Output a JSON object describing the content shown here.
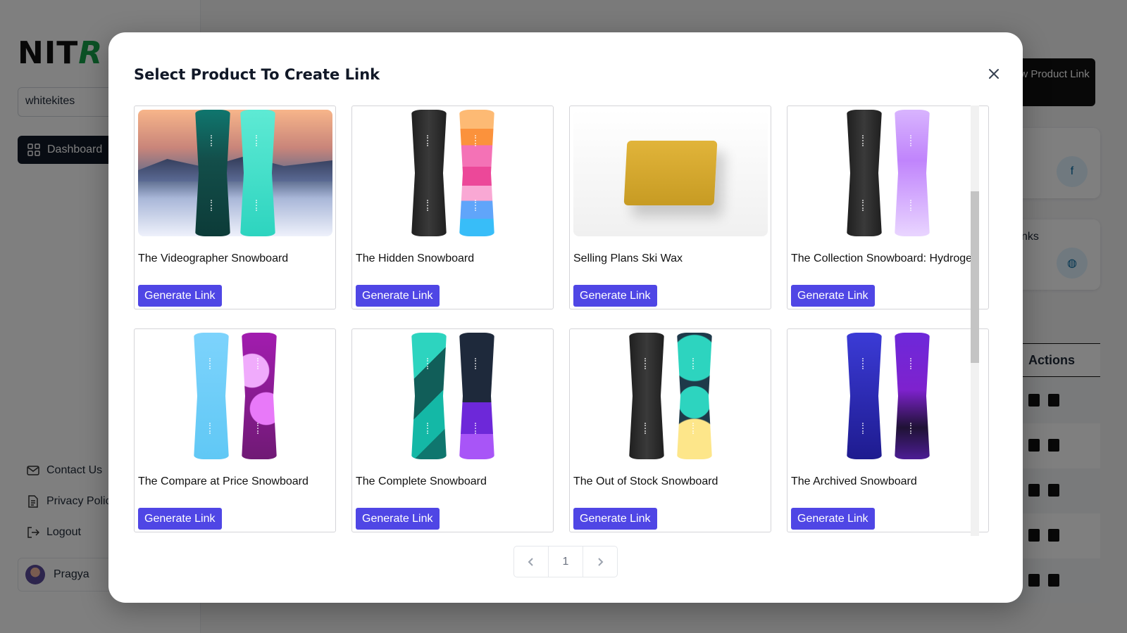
{
  "background": {
    "brand": "NIT",
    "brand_bolt": "R",
    "store_name": "whitekites",
    "nav": {
      "dashboard": "Dashboard"
    },
    "footer_links": {
      "contact": "Contact Us",
      "privacy": "Privacy Polic",
      "logout": "Logout"
    },
    "user_name": "Pragya",
    "new_link_button": "ew Product Link",
    "stat_label": "nks",
    "actions_header": "Actions"
  },
  "modal": {
    "title": "Select Product To Create Link",
    "generate_label": "Generate Link",
    "products": [
      {
        "name": "The Videographer Snowboard",
        "image": "snowboard-hydrogen-mountain"
      },
      {
        "name": "The Hidden Snowboard",
        "image": "snowboard-black-pink-stripes"
      },
      {
        "name": "Selling Plans Ski Wax",
        "image": "ski-wax-bar"
      },
      {
        "name": "The Collection Snowboard: Hydrogen",
        "image": "snowboard-black-purple"
      },
      {
        "name": "The Compare at Price Snowboard",
        "image": "snowboard-blue-magenta"
      },
      {
        "name": "The Complete Snowboard",
        "image": "snowboard-teal-shopify"
      },
      {
        "name": "The Out of Stock Snowboard",
        "image": "snowboard-black-teal-circles"
      },
      {
        "name": "The Archived Snowboard",
        "image": "snowboard-blue-violet-cubes"
      }
    ],
    "pagination": {
      "current_page": "1"
    }
  },
  "colors": {
    "primary_button": "#4f46e5",
    "brand_bolt": "#16a34a"
  }
}
